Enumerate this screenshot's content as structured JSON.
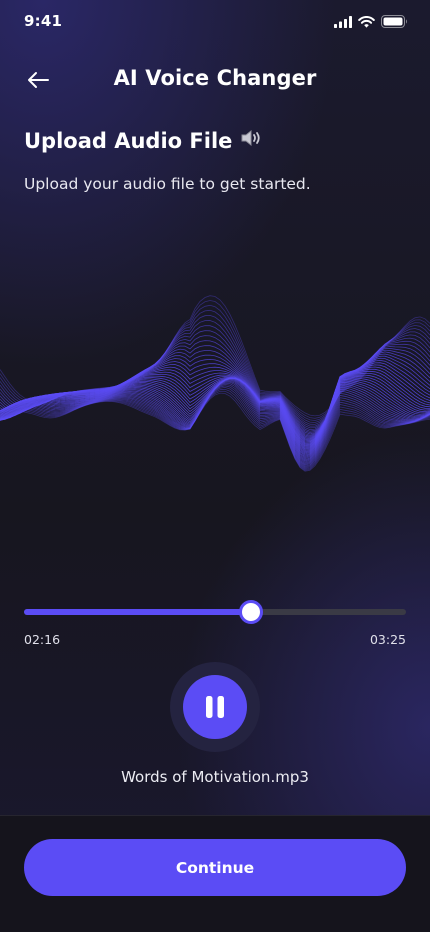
{
  "status_bar": {
    "time": "9:41",
    "icons": [
      "cellular-signal-icon",
      "wifi-icon",
      "battery-icon"
    ]
  },
  "header": {
    "back_icon": "arrow-left-icon",
    "title": "AI Voice Changer"
  },
  "intro": {
    "title": "Upload Audio File",
    "title_icon": "speaker-icon",
    "subtitle": "Upload your audio file to get started."
  },
  "waveform": {
    "icon": "audio-waveform-visual",
    "color": "#5b4cf5"
  },
  "player": {
    "progress": 0.594,
    "current_time": "02:16",
    "total_time": "03:25",
    "state_icon": "pause-icon",
    "file_name": "Words of Motivation.mp3"
  },
  "footer": {
    "continue_label": "Continue"
  },
  "colors": {
    "accent": "#5b4cf5",
    "track": "#3a3a45",
    "background": "#17161f"
  }
}
